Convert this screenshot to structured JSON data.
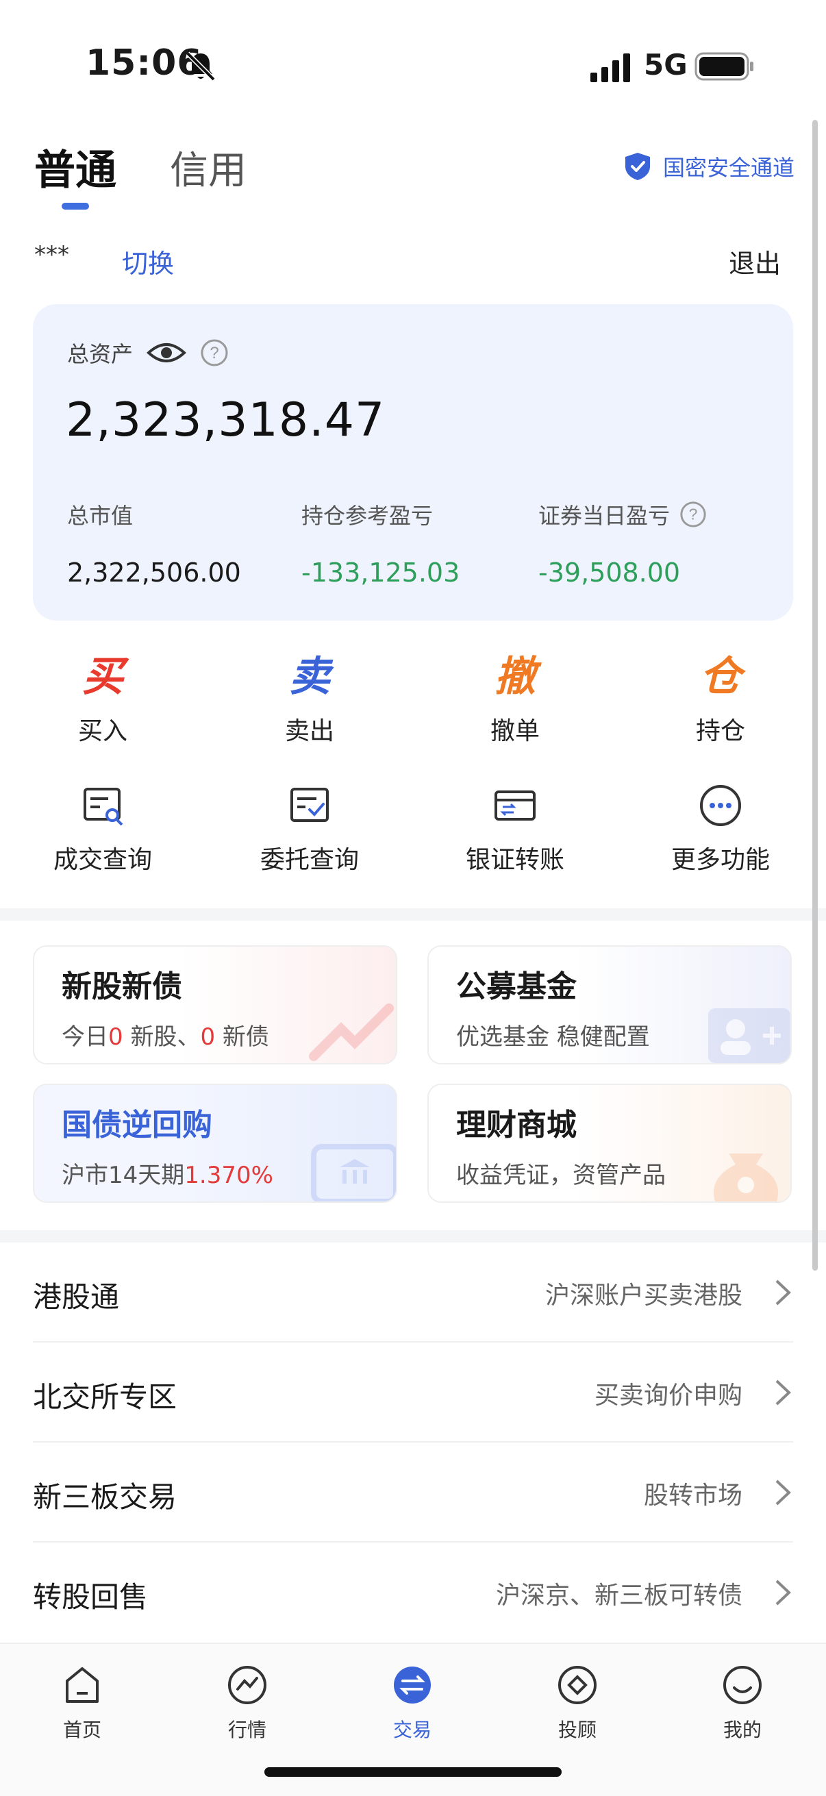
{
  "status": {
    "time": "15:06",
    "network": "5G"
  },
  "header": {
    "tabs": [
      {
        "label": "普通"
      },
      {
        "label": "信用"
      }
    ],
    "secure_channel": "国密安全通道"
  },
  "account": {
    "name": "***",
    "switch_label": "切换",
    "logout_label": "退出"
  },
  "assets": {
    "total_label": "总资产",
    "total_value": "2,323,318.47",
    "market_value_label": "总市值",
    "market_value": "2,322,506.00",
    "position_pnl_label": "持仓参考盈亏",
    "position_pnl": "-133,125.03",
    "daily_pnl_label": "证券当日盈亏",
    "daily_pnl": "-39,508.00"
  },
  "actions": {
    "row1": [
      {
        "glyph": "买",
        "label": "买入",
        "color": "#e83b2e"
      },
      {
        "glyph": "卖",
        "label": "卖出",
        "color": "#3a63d8"
      },
      {
        "glyph": "撤",
        "label": "撤单",
        "color": "#f07a23"
      },
      {
        "glyph": "仓",
        "label": "持仓",
        "color": "#f07a23"
      }
    ],
    "row2": [
      {
        "icon": "trade-query-icon",
        "label": "成交查询"
      },
      {
        "icon": "order-query-icon",
        "label": "委托查询"
      },
      {
        "icon": "bank-transfer-icon",
        "label": "银证转账"
      },
      {
        "icon": "more-icon",
        "label": "更多功能"
      }
    ]
  },
  "features": {
    "ipo": {
      "title": "新股新债",
      "prefix": "今日",
      "stock_count": "0",
      "stock_label": " 新股、",
      "bond_count": "0",
      "bond_label": " 新债"
    },
    "fund": {
      "title": "公募基金",
      "sub": "优选基金 稳健配置"
    },
    "repo": {
      "title": "国债逆回购",
      "sub_prefix": "沪市14天期",
      "rate": "1.370%"
    },
    "wealth": {
      "title": "理财商城",
      "sub": "收益凭证，资管产品"
    }
  },
  "list": [
    {
      "title": "港股通",
      "desc": "沪深账户买卖港股"
    },
    {
      "title": "北交所专区",
      "desc": "买卖询价申购"
    },
    {
      "title": "新三板交易",
      "desc": "股转市场"
    },
    {
      "title": "转股回售",
      "desc": "沪深京、新三板可转债"
    }
  ],
  "nav": [
    {
      "label": "首页",
      "icon": "home-icon"
    },
    {
      "label": "行情",
      "icon": "market-icon"
    },
    {
      "label": "交易",
      "icon": "trade-icon"
    },
    {
      "label": "投顾",
      "icon": "advisor-icon"
    },
    {
      "label": "我的",
      "icon": "profile-icon"
    }
  ],
  "colors": {
    "accent": "#3a63d8",
    "loss": "#2e9f5b",
    "highlight": "#e33a3a"
  }
}
